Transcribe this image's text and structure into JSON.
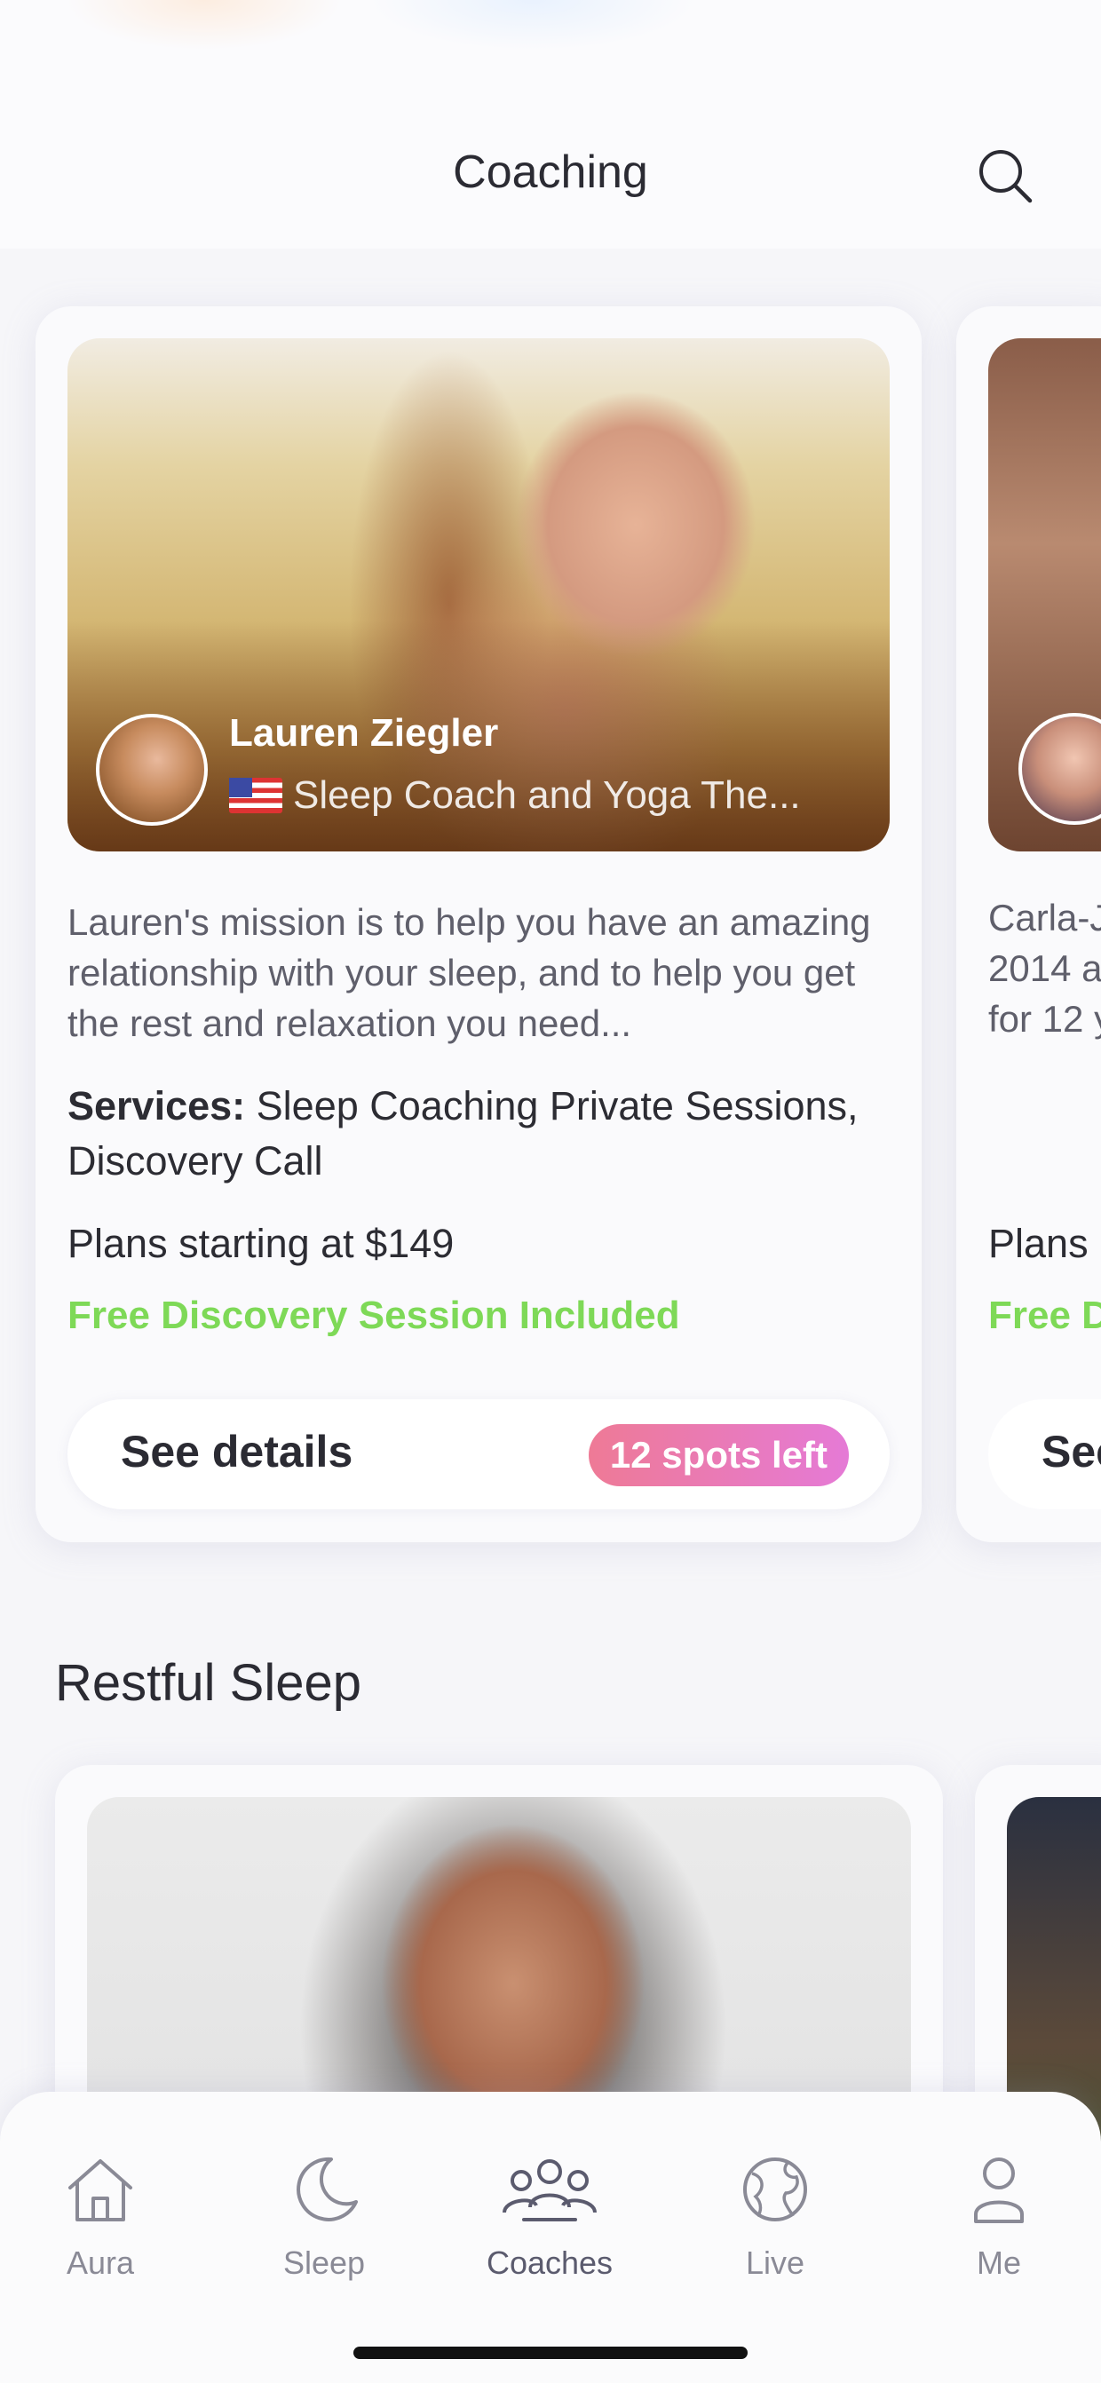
{
  "header": {
    "title": "Coaching"
  },
  "icons": {
    "search": "search-icon"
  },
  "featured_coach": {
    "name": "Lauren Ziegler",
    "flag": "🇺🇸",
    "role": "Sleep Coach and Yoga The...",
    "description": "Lauren's mission is to help you have an amazing relationship with your sleep, and to help you get the rest and relaxation you need...",
    "services_label": "Services:",
    "services_value": "Sleep Coaching Private Sessions, Discovery Call",
    "plans": "Plans starting at $149",
    "free_session": "Free Discovery Session Included",
    "details_button": "See details",
    "spots_badge": "12 spots left"
  },
  "peek_coach": {
    "desc_line1": "Carla-J",
    "desc_line2": "2014 a",
    "desc_line3": "for 12 y",
    "plans": "Plans",
    "free_session": "Free D",
    "details_button": "See"
  },
  "section": {
    "title": "Restful Sleep"
  },
  "tabbar": {
    "items": [
      {
        "label": "Aura",
        "icon": "home-icon"
      },
      {
        "label": "Sleep",
        "icon": "moon-icon"
      },
      {
        "label": "Coaches",
        "icon": "people-icon"
      },
      {
        "label": "Live",
        "icon": "globe-icon"
      },
      {
        "label": "Me",
        "icon": "person-icon"
      }
    ]
  },
  "colors": {
    "accent_green": "#7ed957",
    "badge_gradient_start": "#ee7a96",
    "badge_gradient_end": "#e57ad6"
  }
}
